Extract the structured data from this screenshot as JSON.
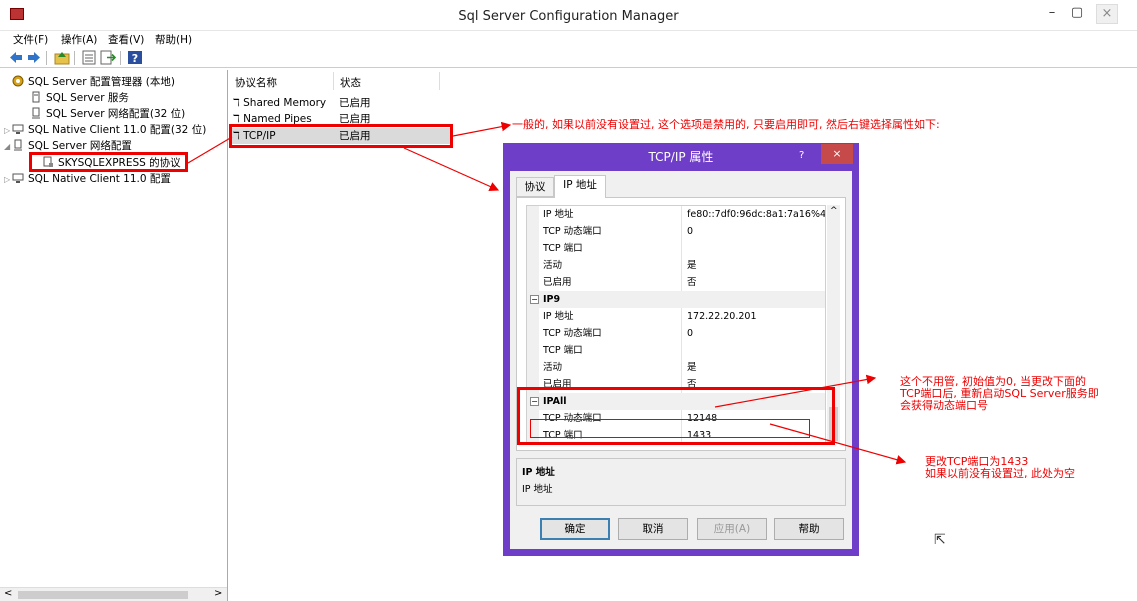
{
  "window": {
    "title": "Sql Server Configuration Manager",
    "minimize": "–",
    "restore": "▢",
    "close": "×"
  },
  "menu": [
    "文件(F)",
    "操作(A)",
    "查看(V)",
    "帮助(H)"
  ],
  "toolbar_icons": [
    "back-icon",
    "forward-icon",
    "up-folder-icon",
    "properties-icon",
    "export-icon",
    "help-icon"
  ],
  "tree": {
    "root": "SQL Server 配置管理器 (本地)",
    "items": [
      "SQL Server 服务",
      "SQL Server 网络配置(32 位)",
      "SQL Native Client 11.0 配置(32 位)",
      "SQL Server 网络配置",
      "SKYSQLEXPRESS 的协议",
      "SQL Native Client 11.0 配置"
    ],
    "scroll_left": "<",
    "scroll_right": ">"
  },
  "list": {
    "columns": [
      "协议名称",
      "状态"
    ],
    "rows": [
      {
        "name": "Shared Memory",
        "status": "已启用"
      },
      {
        "name": "Named Pipes",
        "status": "已启用"
      },
      {
        "name": "TCP/IP",
        "status": "已启用"
      }
    ]
  },
  "dialog": {
    "title": "TCP/IP 属性",
    "help": "?",
    "close": "×",
    "tabs": [
      "协议",
      "IP 地址"
    ],
    "grid": {
      "ip8": [
        {
          "key": "IP 地址",
          "value": "fe80::7df0:96dc:8a1:7a16%4"
        },
        {
          "key": "TCP 动态端口",
          "value": "0"
        },
        {
          "key": "TCP 端口",
          "value": ""
        },
        {
          "key": "活动",
          "value": "是"
        },
        {
          "key": "已启用",
          "value": "否"
        }
      ],
      "ip9_title": "IP9",
      "ip9": [
        {
          "key": "IP 地址",
          "value": "172.22.20.201"
        },
        {
          "key": "TCP 动态端口",
          "value": "0"
        },
        {
          "key": "TCP 端口",
          "value": ""
        },
        {
          "key": "活动",
          "value": "是"
        },
        {
          "key": "已启用",
          "value": "否"
        }
      ],
      "ipall_title": "IPAll",
      "ipall": [
        {
          "key": "TCP 动态端口",
          "value": "12148"
        },
        {
          "key": "TCP 端口",
          "value": "1433"
        }
      ],
      "collapse_glyph": "−",
      "scroll_up": "^"
    },
    "description": {
      "title": "IP 地址",
      "text": "IP 地址"
    },
    "buttons": {
      "ok": "确定",
      "cancel": "取消",
      "apply": "应用(A)",
      "help": "帮助"
    }
  },
  "annotations": {
    "note1": "一般的, 如果以前没有设置过, 这个选项是禁用的, 只要启用即可, 然后右键选择属性如下:",
    "note2": [
      "这个不用管, 初始值为0, 当更改下面的",
      "TCP端口后, 重新启动SQL Server服务即",
      "会获得动态端口号"
    ],
    "note3": [
      "更改TCP端口为1433",
      "如果以前没有设置过, 此处为空"
    ],
    "color": "#e00000"
  }
}
